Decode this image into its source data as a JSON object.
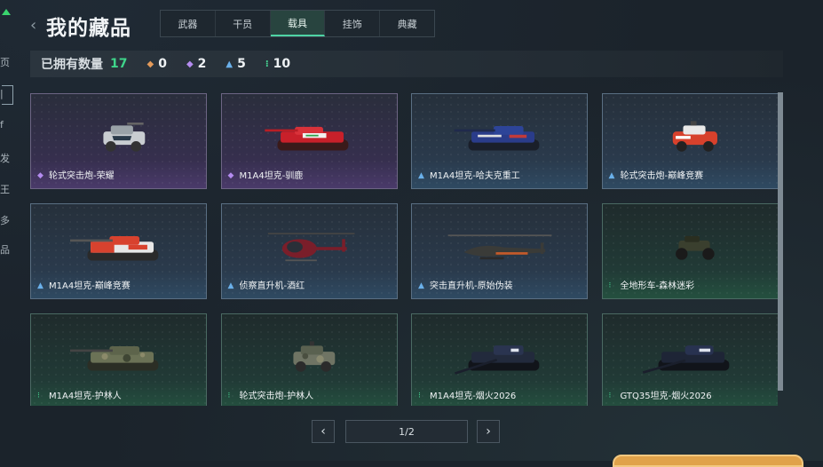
{
  "header": {
    "title": "我的藏品",
    "back_glyph": "‹"
  },
  "left_strip": {
    "fragments": [
      "页",
      "|",
      "f",
      "发",
      "王",
      "多",
      "品"
    ]
  },
  "tabs": [
    {
      "label": "武器",
      "active": false
    },
    {
      "label": "干员",
      "active": false
    },
    {
      "label": "载具",
      "active": true
    },
    {
      "label": "挂饰",
      "active": false
    },
    {
      "label": "典藏",
      "active": false
    }
  ],
  "stats": {
    "label": "已拥有数量",
    "count": "17",
    "rarity_counts": [
      {
        "icon": "orange-diamond-icon",
        "glyph": "◆",
        "color": "#e39a5a",
        "value": "0"
      },
      {
        "icon": "purple-diamond-icon",
        "glyph": "◆",
        "color": "#b48cf0",
        "value": "2"
      },
      {
        "icon": "blue-chevron-icon",
        "glyph": "▲",
        "color": "#6ab0ea",
        "value": "5"
      },
      {
        "icon": "green-dots-icon",
        "glyph": "⁝",
        "color": "#46d694",
        "value": "10"
      }
    ]
  },
  "items": [
    {
      "name": "轮式突击炮-荣耀",
      "rarity": "purple",
      "vehicle": "armored-car"
    },
    {
      "name": "M1A4坦克-驯鹿",
      "rarity": "purple",
      "vehicle": "tank-red"
    },
    {
      "name": "M1A4坦克-哈夫克重工",
      "rarity": "blue",
      "vehicle": "tank-blue"
    },
    {
      "name": "轮式突击炮-巅峰竞赛",
      "rarity": "blue",
      "vehicle": "armored-car-red"
    },
    {
      "name": "M1A4坦克-巅峰竞赛",
      "rarity": "blue",
      "vehicle": "tank-redwhite"
    },
    {
      "name": "侦察直升机-酒红",
      "rarity": "blue",
      "vehicle": "heli-small"
    },
    {
      "name": "突击直升机-原始伪装",
      "rarity": "blue",
      "vehicle": "heli-attack"
    },
    {
      "name": "全地形车-森林迷彩",
      "rarity": "green",
      "vehicle": "atv"
    },
    {
      "name": "M1A4坦克-护林人",
      "rarity": "green",
      "vehicle": "tank-camo"
    },
    {
      "name": "轮式突击炮-护林人",
      "rarity": "green",
      "vehicle": "armored-car-camo"
    },
    {
      "name": "M1A4坦克-烟火2026",
      "rarity": "green",
      "vehicle": "tank-dark"
    },
    {
      "name": "GTQ35坦克-烟火2026",
      "rarity": "green",
      "vehicle": "tank-dark2"
    }
  ],
  "pagination": {
    "prev_glyph": "‹",
    "next_glyph": "›",
    "label": "1/2"
  },
  "colors": {
    "accent": "#3fd58a",
    "purple": "#b48cf0",
    "blue": "#6ab0ea",
    "green": "#46d694",
    "orange": "#e39a5a"
  }
}
